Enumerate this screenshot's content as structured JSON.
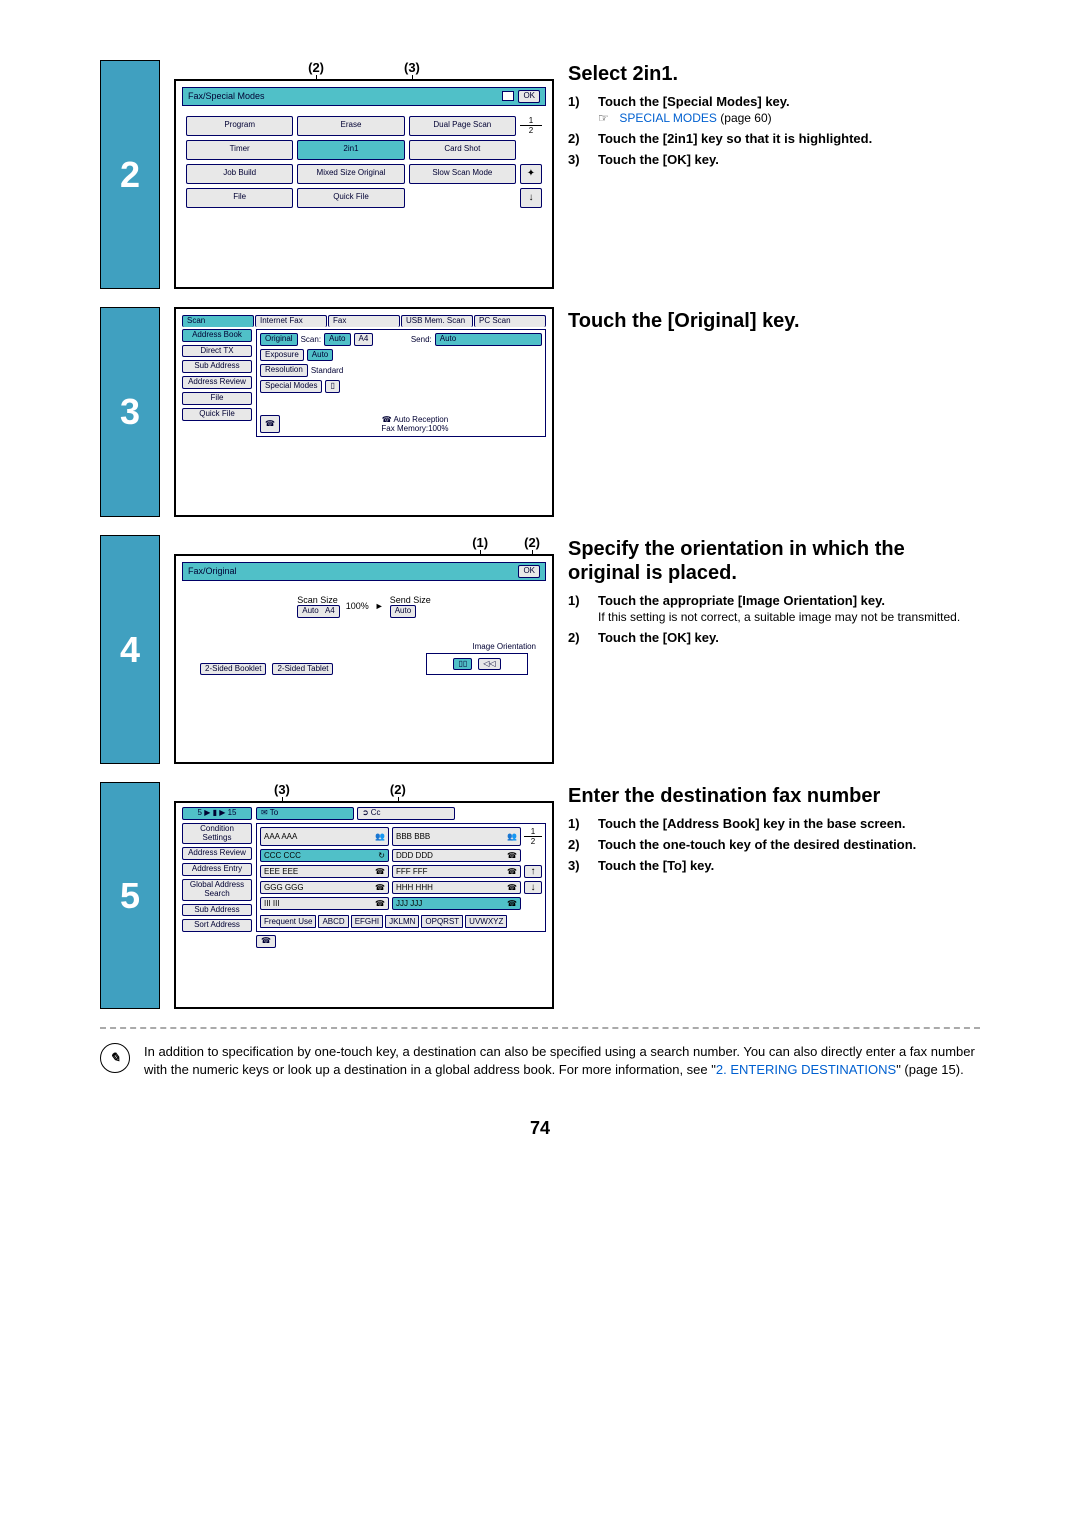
{
  "page_number": "74",
  "steps": {
    "s2": {
      "num": "2",
      "title": "Select 2in1.",
      "callouts": [
        "(2)",
        "(3)"
      ],
      "titlebar_left": "Fax/Special Modes",
      "titlebar_right": "OK",
      "buttons": {
        "r1c1": "Program",
        "r1c2": "Erase",
        "r1c3": "Dual Page Scan",
        "r2c1": "Timer",
        "r2c2": "2in1",
        "r2c3": "Card Shot",
        "r3c1": "Job Build",
        "r3c2": "Mixed Size Original",
        "r3c3": "Slow Scan Mode",
        "r4c1": "File",
        "r4c2": "Quick File"
      },
      "frac_top": "1",
      "frac_bot": "2",
      "instr": [
        {
          "n": "1)",
          "t": "Touch the [Special Modes] key.",
          "link": "SPECIAL MODES",
          "link_after": "(page 60)"
        },
        {
          "n": "2)",
          "t": "Touch the [2in1] key so that it is highlighted."
        },
        {
          "n": "3)",
          "t": "Touch the [OK] key."
        }
      ]
    },
    "s3": {
      "num": "3",
      "title": "Touch the [Original] key.",
      "tabs": [
        "Scan",
        "Internet Fax",
        "Fax",
        "USB Mem. Scan",
        "PC Scan"
      ],
      "side": [
        "Address Book",
        "Direct TX",
        "Sub Address",
        "Address Review",
        "File",
        "Quick File"
      ],
      "rows": {
        "original": "Original",
        "scan": "Scan:",
        "scan_v": "Auto",
        "doc": "A4",
        "send": "Send:",
        "send_v": "Auto",
        "exposure": "Exposure",
        "exp_v": "Auto",
        "resolution": "Resolution",
        "res_v": "Standard",
        "special": "Special Modes"
      },
      "footer_top": "Auto Reception",
      "footer_bot": "Fax Memory:100%"
    },
    "s4": {
      "num": "4",
      "title": "Specify the orientation in which the original is placed.",
      "callouts": [
        "(1)",
        "(2)"
      ],
      "titlebar_left": "Fax/Original",
      "titlebar_right": "OK",
      "scan_size_lbl": "Scan Size",
      "pct": "100%",
      "send_size_lbl": "Send Size",
      "auto": "Auto",
      "a4": "A4",
      "orient_lbl": "Image Orientation",
      "two_booklet": "2-Sided Booklet",
      "two_tablet": "2-Sided Tablet",
      "instr": [
        {
          "n": "1)",
          "t": "Touch the appropriate [Image Orientation] key.",
          "sub": "If this setting is not correct, a suitable image may not be transmitted."
        },
        {
          "n": "2)",
          "t": "Touch the [OK] key."
        }
      ]
    },
    "s5": {
      "num": "5",
      "title": "Enter the destination fax number",
      "callouts": [
        "(3)",
        "(2)"
      ],
      "topleft": "5 ▶ ▮ ▶ 15",
      "to": "To",
      "cc": "Cc",
      "side": [
        "Condition Settings",
        "Address Review",
        "Address Entry",
        "Global Address Search",
        "Sub Address",
        "Sort Address"
      ],
      "entries": [
        "AAA AAA",
        "BBB BBB",
        "CCC CCC",
        "DDD DDD",
        "EEE EEE",
        "FFF FFF",
        "GGG GGG",
        "HHH HHH",
        "III III",
        "JJJ JJJ"
      ],
      "frac_top": "1",
      "frac_bot": "2",
      "index_tabs": [
        "Frequent Use",
        "ABCD",
        "EFGHI",
        "JKLMN",
        "OPQRST",
        "UVWXYZ"
      ],
      "instr": [
        {
          "n": "1)",
          "t": "Touch the [Address Book] key in the base screen."
        },
        {
          "n": "2)",
          "t": "Touch the one-touch key of the desired destination."
        },
        {
          "n": "3)",
          "t": "Touch the [To] key."
        }
      ]
    }
  },
  "note": {
    "text_a": "In addition to specification by one-touch key, a destination can also be specified using a search number. You can also directly enter a fax number with the numeric keys or look up a destination in a global address book. For more information, see \"",
    "link": "2. ENTERING DESTINATIONS",
    "text_b": "\" (page 15)."
  }
}
